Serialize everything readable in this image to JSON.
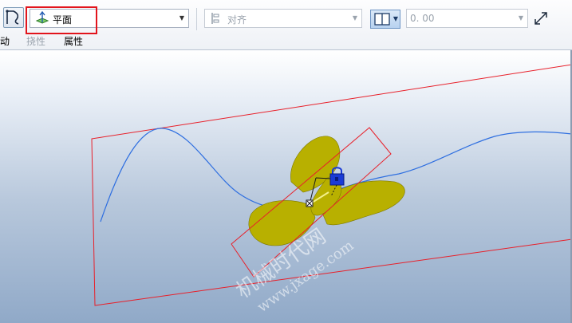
{
  "toolbar": {
    "plane_selector": {
      "value": "平面"
    },
    "align_selector": {
      "placeholder": "对齐"
    },
    "offset_field": {
      "value": "0. 00"
    }
  },
  "tabs": {
    "placement": "动",
    "flexibility": "挠性",
    "properties": "属性"
  },
  "watermark": {
    "line1": "机械时代网",
    "line2": "www.jxage.com"
  },
  "colors": {
    "highlight": "#e2141c",
    "plane_outline": "#e8202a",
    "curve": "#2f6fe0",
    "surface": "#b8b000",
    "lock": "#1a3bd6"
  }
}
